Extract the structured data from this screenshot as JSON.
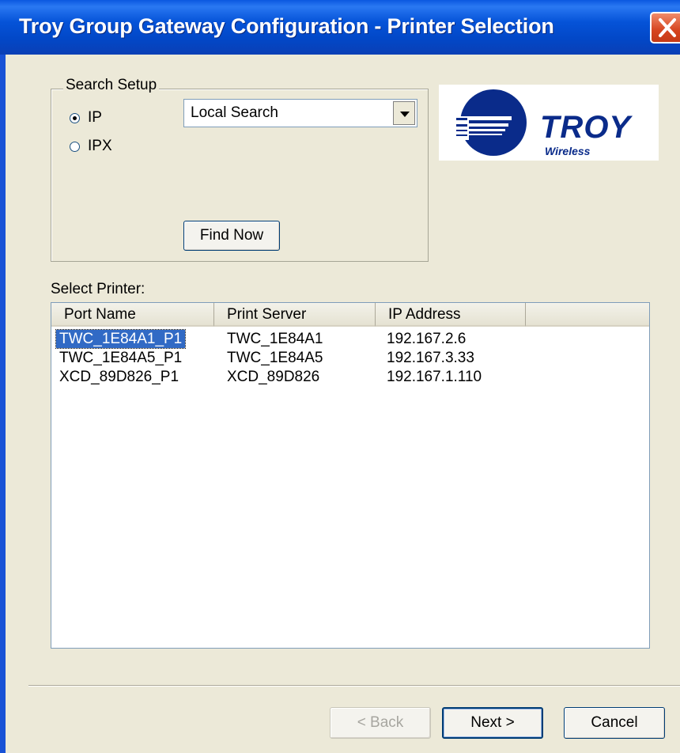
{
  "window": {
    "title": "Troy Group Gateway Configuration - Printer Selection"
  },
  "search_setup": {
    "legend": "Search Setup",
    "options": [
      {
        "label": "IP",
        "checked": true
      },
      {
        "label": "IPX",
        "checked": false
      }
    ],
    "search_mode": "Local Search",
    "find_now_label": "Find Now"
  },
  "logo": {
    "brand": "TROY",
    "tagline": "Wireless",
    "brand_color": "#0a2b8a"
  },
  "printer_list": {
    "label": "Select Printer:",
    "columns": [
      "Port Name",
      "Print Server",
      "IP Address"
    ],
    "rows": [
      {
        "port": "TWC_1E84A1_P1",
        "server": "TWC_1E84A1",
        "ip": "192.167.2.6",
        "selected": true
      },
      {
        "port": "TWC_1E84A5_P1",
        "server": "TWC_1E84A5",
        "ip": "192.167.3.33",
        "selected": false
      },
      {
        "port": "XCD_89D826_P1",
        "server": "XCD_89D826",
        "ip": "192.167.1.110",
        "selected": false
      }
    ]
  },
  "footer": {
    "back_label": "< Back",
    "next_label": "Next >",
    "cancel_label": "Cancel"
  }
}
